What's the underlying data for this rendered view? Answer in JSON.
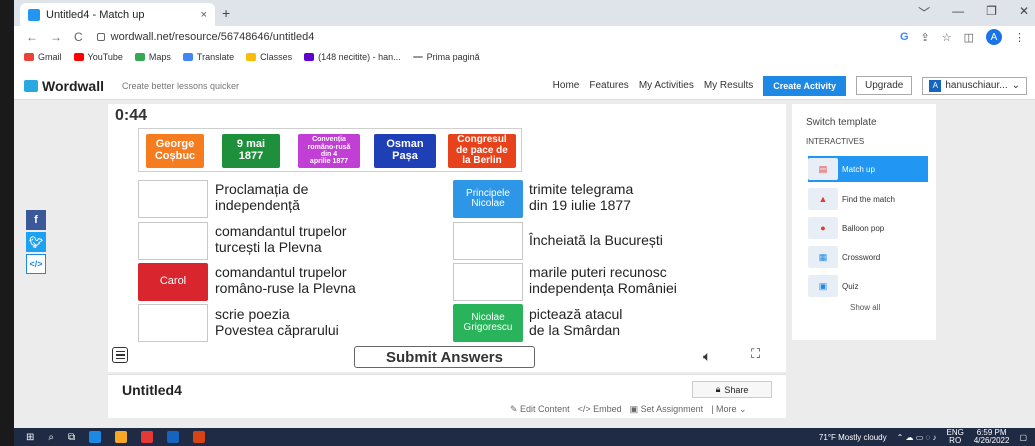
{
  "browser": {
    "tab_title": "Untitled4 - Match up",
    "tab_close": "×",
    "new_tab": "+",
    "window_controls": [
      "﹀",
      "—",
      "❐",
      "✕"
    ],
    "url": "wordwall.net/resource/56748646/untitled4",
    "profile_letter": "A",
    "bookmarks": [
      "Gmail",
      "YouTube",
      "Maps",
      "Translate",
      "Classes",
      "(148 necitite) - han...",
      "Prima pagină"
    ]
  },
  "header": {
    "logo": "Wordwall",
    "tagline": "Create better lessons quicker",
    "nav": [
      "Home",
      "Features",
      "My Activities",
      "My Results"
    ],
    "create_activity": "Create Activity",
    "upgrade": "Upgrade",
    "user_letter": "A",
    "user_name": "hanuschiaur..."
  },
  "activity": {
    "timer": "0:44",
    "bank_tiles": [
      {
        "lines": [
          "George",
          "Coșbuc"
        ],
        "color": "#f57c1f"
      },
      {
        "lines": [
          "9 mai",
          "1877"
        ],
        "color": "#1e8f3a"
      },
      {
        "lines": [
          "Convenția",
          "româno-rusă",
          "din 4",
          "aprilie 1877"
        ],
        "color": "#c13fd4"
      },
      {
        "lines": [
          "Osman",
          "Pașa"
        ],
        "color": "#1f3fb6"
      },
      {
        "lines": [
          "Congresul",
          "de pace de",
          "la Berlin"
        ],
        "color": "#e8421c"
      }
    ],
    "clues_left": [
      {
        "line1": "Proclamația de",
        "line2": "independență"
      },
      {
        "line1": "comandantul trupelor",
        "line2": "turcești la Plevna"
      },
      {
        "line1": "comandantul trupelor",
        "line2": "româno-ruse la Plevna"
      },
      {
        "line1": "scrie poezia",
        "line2": "Povestea căprarului"
      }
    ],
    "clues_right": [
      {
        "line1": "trimite telegrama",
        "line2": "din 19 iulie 1877"
      },
      {
        "line1": "Încheiată la București",
        "line2": ""
      },
      {
        "line1": "marile puteri recunosc",
        "line2": "independența României"
      },
      {
        "line1": "pictează atacul",
        "line2": "de la Smârdan"
      }
    ],
    "placed_tiles": [
      {
        "label1": "Principele",
        "label2": "Nicolae",
        "color": "#2e96e6"
      },
      {
        "label1": "Carol",
        "label2": "",
        "color": "#d9252e"
      },
      {
        "label1": "Nicolae",
        "label2": "Grigorescu",
        "color": "#29b35a"
      }
    ],
    "submit": "Submit Answers"
  },
  "info": {
    "title": "Untitled4",
    "share": "Share",
    "edit_content": "Edit Content",
    "embed": "Embed",
    "set_assignment": "Set Assignment",
    "more": "More"
  },
  "sidebar": {
    "switch_template": "Switch template",
    "section": "INTERACTIVES",
    "templates": [
      "Match up",
      "Find the match",
      "Balloon pop",
      "Crossword",
      "Quiz"
    ],
    "show_all": "Show all"
  },
  "taskbar": {
    "weather": "71°F  Mostly cloudy",
    "lang1": "ENG",
    "lang2": "RO",
    "time": "6:59 PM",
    "date": "4/26/2022"
  },
  "colors": {
    "accent": "#2196f3",
    "facebook": "#3b5998",
    "twitter": "#1da1f2"
  }
}
